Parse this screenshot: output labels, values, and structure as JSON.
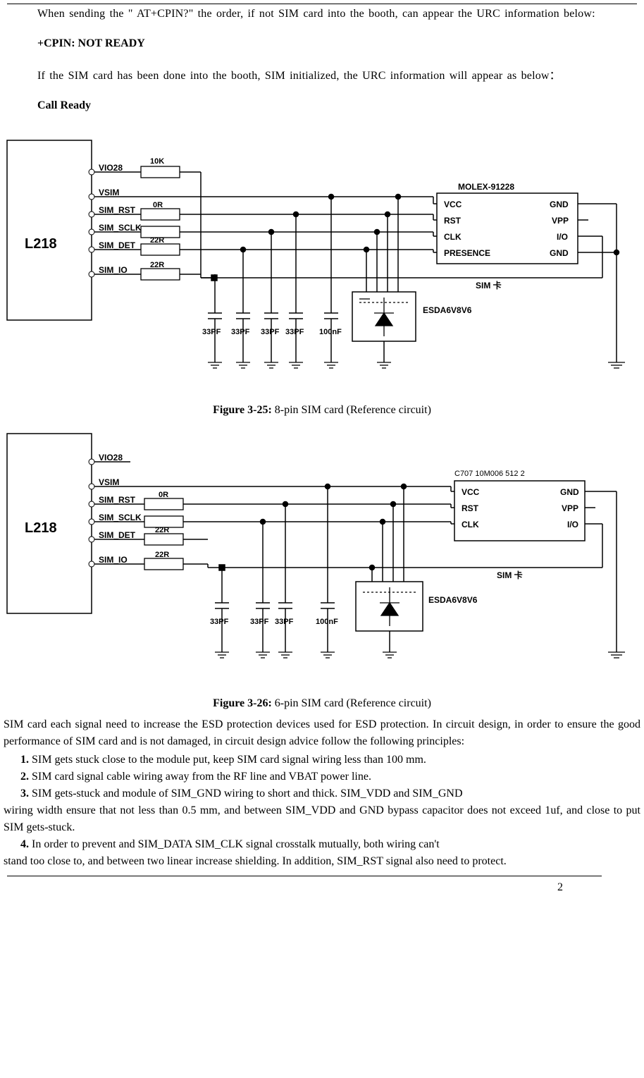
{
  "paragraphs": {
    "p1": "When sending the \" AT+CPIN?\" the order, if not SIM card into the booth, can appear the URC information below:",
    "p2": "+CPIN: NOT READY",
    "p3": "If the SIM card has been done into the booth, SIM initialized, the URC information will appear as below：",
    "p4": "Call Ready"
  },
  "figures": {
    "f25": {
      "label": "Figure 3-25:",
      "caption": " 8-pin SIM card (Reference circuit)",
      "chip": "L218",
      "chip_pins": [
        "VIO28",
        "VSIM",
        "SIM_RST",
        "SIM_SCLK",
        "SIM_DET",
        "SIM_IO"
      ],
      "resistors": [
        "10K",
        "0R",
        "22R",
        "22R"
      ],
      "caps": [
        "33PF",
        "33PF",
        "33PF",
        "33PF",
        "100nF"
      ],
      "esd": "ESDA6V8V6",
      "sim_label": "SIM 卡",
      "holder": "MOLEX-91228",
      "holder_left": [
        "VCC",
        "RST",
        "CLK",
        "PRESENCE"
      ],
      "holder_right": [
        "GND",
        "VPP",
        "I/O",
        "GND"
      ]
    },
    "f26": {
      "label": "Figure 3-26:",
      "caption": " 6-pin SIM card (Reference circuit)",
      "chip": "L218",
      "chip_pins": [
        "VIO28",
        "VSIM",
        "SIM_RST",
        "SIM_SCLK",
        "SIM_DET",
        "SIM_IO"
      ],
      "resistors": [
        "0R",
        "22R",
        "22R"
      ],
      "caps": [
        "33PF",
        "33PF",
        "33PF",
        "100nF"
      ],
      "esd": "ESDA6V8V6",
      "sim_label": "SIM 卡",
      "holder": "C707 10M006 512 2",
      "holder_left": [
        "VCC",
        "RST",
        "CLK"
      ],
      "holder_right": [
        "GND",
        "VPP",
        "I/O"
      ]
    }
  },
  "body": {
    "esd_intro": "SIM card each signal need to increase the ESD protection devices used for ESD protection. In circuit design, in order to ensure the good performance of SIM card and is not damaged, in circuit design advice follow the following principles:",
    "p1": "SIM gets stuck close to the module put, keep SIM card signal wiring less than 100 mm.",
    "p2": "SIM card signal cable wiring away from the RF line and VBAT power line.",
    "p3a": "SIM gets-stuck and module of SIM_GND wiring to short and thick. SIM_VDD and SIM_GND",
    "p3b": "wiring width ensure that not less than 0.5 mm, and between SIM_VDD and GND bypass capacitor does not exceed 1uf, and close to put SIM gets-stuck.",
    "p4a": "In order to prevent and SIM_DATA SIM_CLK signal crosstalk mutually, both wiring can't",
    "p4b": "stand too close to, and between two linear increase shielding. In addition, SIM_RST signal also need to protect.",
    "num1": "1. ",
    "num2": "2. ",
    "num3": "3. ",
    "num4": "4. "
  },
  "page_number": "2"
}
